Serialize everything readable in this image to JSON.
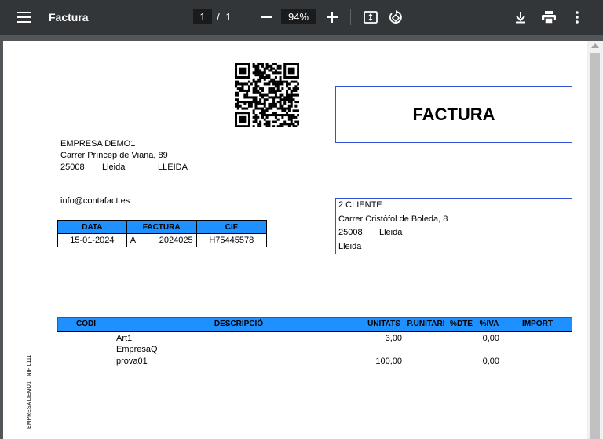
{
  "toolbar": {
    "title": "Factura",
    "current_page": "1",
    "page_separator": "/",
    "total_pages": "1",
    "zoom": "94%"
  },
  "document": {
    "doc_title": "FACTURA",
    "company": {
      "name": "EMPRESA DEMO1",
      "street": "Carrer Príncep de Viana, 89",
      "postcode": "25008",
      "city": "Lleida",
      "province": "LLEIDA",
      "email": "info@contafact.es"
    },
    "invoice_header": {
      "col_date": "DATA",
      "col_invoice": "FACTURA",
      "col_cif": "CIF",
      "date": "15-01-2024",
      "series": "A",
      "number": "2024025",
      "cif": "H75445578"
    },
    "client": {
      "name": "2 CLIENTE",
      "street": "Carrer Cristòfol de Boleda, 8",
      "postcode": "25008",
      "city": "Lleida",
      "city2": "Lleida"
    },
    "lines_table": {
      "headers": [
        "CODI",
        "DESCRIPCIÓ",
        "UNITATS",
        "P.UNITARI",
        "%DTE",
        "%IVA",
        "IMPORT"
      ],
      "rows": [
        {
          "code": "",
          "description": "Art1",
          "units": "3,00",
          "unit_price": "",
          "discount": "",
          "vat": "0,00",
          "amount": ""
        },
        {
          "code": "",
          "description": "EmpresaQ",
          "units": "",
          "unit_price": "",
          "discount": "",
          "vat": "",
          "amount": ""
        },
        {
          "code": "",
          "description": "prova01",
          "units": "100,00",
          "unit_price": "",
          "discount": "",
          "vat": "0,00",
          "amount": ""
        }
      ]
    },
    "side_text": "EMPRESA DEMO1   NIF L111"
  }
}
